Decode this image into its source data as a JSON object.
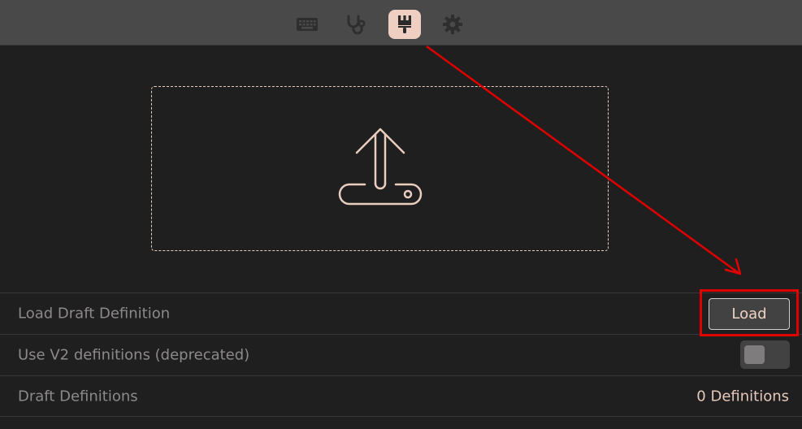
{
  "toolbar": {
    "tabs": [
      {
        "icon": "keyboard-icon",
        "active": false
      },
      {
        "icon": "stethoscope-icon",
        "active": false
      },
      {
        "icon": "brush-icon",
        "active": true
      },
      {
        "icon": "gear-icon",
        "active": false
      }
    ]
  },
  "dropzone": {
    "icon": "upload-icon"
  },
  "settings": {
    "load_draft": {
      "label": "Load Draft Definition",
      "button_label": "Load"
    },
    "use_v2": {
      "label": "Use V2 definitions (deprecated)",
      "enabled": false
    },
    "draft_definitions": {
      "label": "Draft Definitions",
      "value": "0 Definitions"
    }
  },
  "colors": {
    "accent": "#efcfc1",
    "annotation": "#e00000",
    "background": "#201f1f",
    "topbar": "#4a4949"
  }
}
